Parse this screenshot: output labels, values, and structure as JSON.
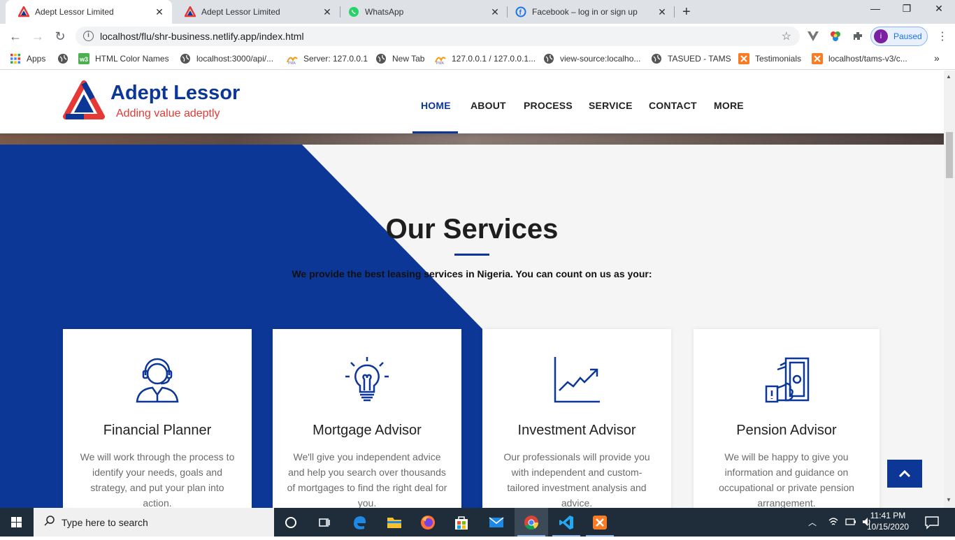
{
  "browser": {
    "tabs": [
      {
        "title": "Adept Lessor Limited",
        "active": true
      },
      {
        "title": "Adept Lessor Limited",
        "active": false
      },
      {
        "title": "WhatsApp",
        "active": false
      },
      {
        "title": "Facebook – log in or sign up",
        "active": false
      }
    ],
    "url": "localhost/flu/shr-business.netlify.app/index.html",
    "profile_label": "Paused",
    "profile_initial": "i",
    "bookmarks": [
      {
        "label": "Apps",
        "icon": "apps-grid-icon"
      },
      {
        "label": "",
        "icon": "globe-icon"
      },
      {
        "label": "HTML Color Names",
        "icon": "w3-icon"
      },
      {
        "label": "localhost:3000/api/...",
        "icon": "globe-icon"
      },
      {
        "label": "Server: 127.0.0.1",
        "icon": "phpmyadmin-icon"
      },
      {
        "label": "New Tab",
        "icon": "globe-icon"
      },
      {
        "label": "127.0.0.1 / 127.0.0.1...",
        "icon": "phpmyadmin-icon"
      },
      {
        "label": "view-source:localho...",
        "icon": "globe-icon"
      },
      {
        "label": "TASUED - TAMS",
        "icon": "globe-icon"
      },
      {
        "label": "Testimonials",
        "icon": "xampp-icon"
      },
      {
        "label": "localhost/tams-v3/c...",
        "icon": "xampp-icon"
      }
    ]
  },
  "site": {
    "brand": "Adept Lessor",
    "tagline": "Adding value adeptly",
    "nav": [
      "HOME",
      "ABOUT",
      "PROCESS",
      "SERVICE",
      "CONTACT",
      "MORE"
    ],
    "active_nav": "HOME",
    "accent_color": "#0c3796",
    "tagline_color": "#e53935"
  },
  "services": {
    "title": "Our Services",
    "subtitle": "We provide the best leasing services in Nigeria. You can count on us as your:",
    "cards": [
      {
        "icon": "headset-person-icon",
        "title": "Financial Planner",
        "text": "We will work through the process to identify your needs, goals and strategy, and put your plan into action."
      },
      {
        "icon": "lightbulb-icon",
        "title": "Mortgage Advisor",
        "text": "We'll give you independent advice and help you search over thousands of mortgages to find the right deal for you."
      },
      {
        "icon": "line-chart-icon",
        "title": "Investment Advisor",
        "text": "Our professionals will provide you with independent and custom-tailored investment analysis and advice."
      },
      {
        "icon": "hand-cash-icon",
        "title": "Pension Advisor",
        "text": "We will be happy to give you information and guidance on occupational or private pension arrangement."
      }
    ]
  },
  "taskbar": {
    "search_placeholder": "Type here to search",
    "time": "11:41 PM",
    "date": "10/15/2020"
  }
}
